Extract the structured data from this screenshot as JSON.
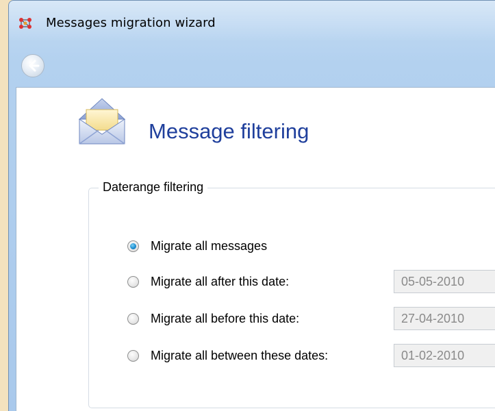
{
  "window": {
    "title": "Messages migration wizard"
  },
  "page": {
    "heading": "Message filtering"
  },
  "daterange": {
    "legend": "Daterange filtering",
    "options": [
      {
        "label": "Migrate all messages",
        "checked": true
      },
      {
        "label": "Migrate all after this date:",
        "checked": false,
        "date": "05-05-2010"
      },
      {
        "label": "Migrate all before this date:",
        "checked": false,
        "date": "27-04-2010"
      },
      {
        "label": "Migrate all between these dates:",
        "checked": false,
        "date": "01-02-2010"
      }
    ]
  },
  "colors": {
    "heading": "#1f3f9c",
    "radio_selected": "#1d8fd1",
    "window_frame": "#b3d1ef",
    "background": "#f3e2be"
  },
  "icons": {
    "app": "network-icon",
    "back": "back-arrow-icon",
    "page": "envelope-icon"
  }
}
